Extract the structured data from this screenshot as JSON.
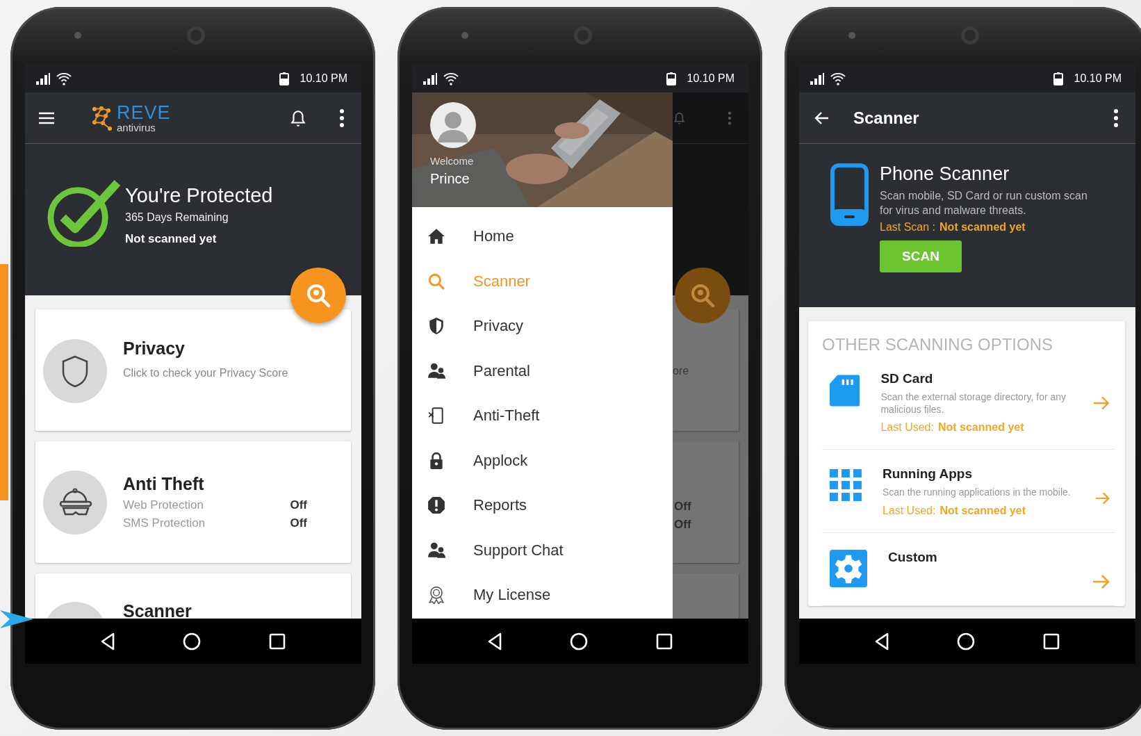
{
  "screens": [
    {
      "kind": "home",
      "status_bar": {
        "time": "10.10 PM"
      },
      "app_bar": {
        "logo_name": "REVE",
        "logo_tagline": "antivirus"
      },
      "status": {
        "title": "You're Protected",
        "days": "365 Days Remaining",
        "scan": "Not scanned yet"
      },
      "cards": [
        {
          "kind": "privacy",
          "title": "Privacy",
          "subtitle": "Click to check your Privacy Score"
        },
        {
          "kind": "anti_theft",
          "title": "Anti Theft",
          "rows": [
            {
              "label": "Web Protection",
              "value": "Off"
            },
            {
              "label": "SMS Protection",
              "value": "Off"
            }
          ]
        },
        {
          "kind": "scanner",
          "title": "Scanner"
        }
      ]
    },
    {
      "kind": "drawer",
      "status_bar": {
        "time": "10.10 PM"
      },
      "user": {
        "greeting": "Welcome",
        "name": "Prince"
      },
      "menu": [
        {
          "kind": "home",
          "label": "Home",
          "selected": false
        },
        {
          "kind": "search",
          "label": "Scanner",
          "selected": true
        },
        {
          "kind": "shield",
          "label": "Privacy",
          "selected": false
        },
        {
          "kind": "people",
          "label": "Parental",
          "selected": false
        },
        {
          "kind": "phone_x",
          "label": "Anti-Theft",
          "selected": false
        },
        {
          "kind": "lock",
          "label": "Applock",
          "selected": false
        },
        {
          "kind": "alert",
          "label": "Reports",
          "selected": false
        },
        {
          "kind": "people",
          "label": "Support Chat",
          "selected": false
        },
        {
          "kind": "award",
          "label": "My License",
          "selected": false
        }
      ],
      "behind": {
        "privacy_text": "ore",
        "values": [
          "Off",
          "Off"
        ]
      }
    },
    {
      "kind": "scanner",
      "status_bar": {
        "time": "10.10 PM"
      },
      "app_bar": {
        "title": "Scanner"
      },
      "phone_scan": {
        "title": "Phone Scanner",
        "description": "Scan mobile, SD Card or run custom scan for virus and malware threats.",
        "last_label": "Last Scan :",
        "last_value": "Not scanned yet",
        "button": "SCAN"
      },
      "options": {
        "heading": "OTHER SCANNING OPTIONS",
        "items": [
          {
            "kind": "sd",
            "title": "SD Card",
            "description": "Scan the external storage directory, for any malicious files.",
            "last_label": "Last Used:",
            "last_value": "Not scanned yet"
          },
          {
            "kind": "apps",
            "title": "Running Apps",
            "description": "Scan the running applications in the mobile.",
            "last_label": "Last Used:",
            "last_value": "Not scanned yet"
          },
          {
            "kind": "gear",
            "title": "Custom"
          }
        ]
      }
    }
  ]
}
